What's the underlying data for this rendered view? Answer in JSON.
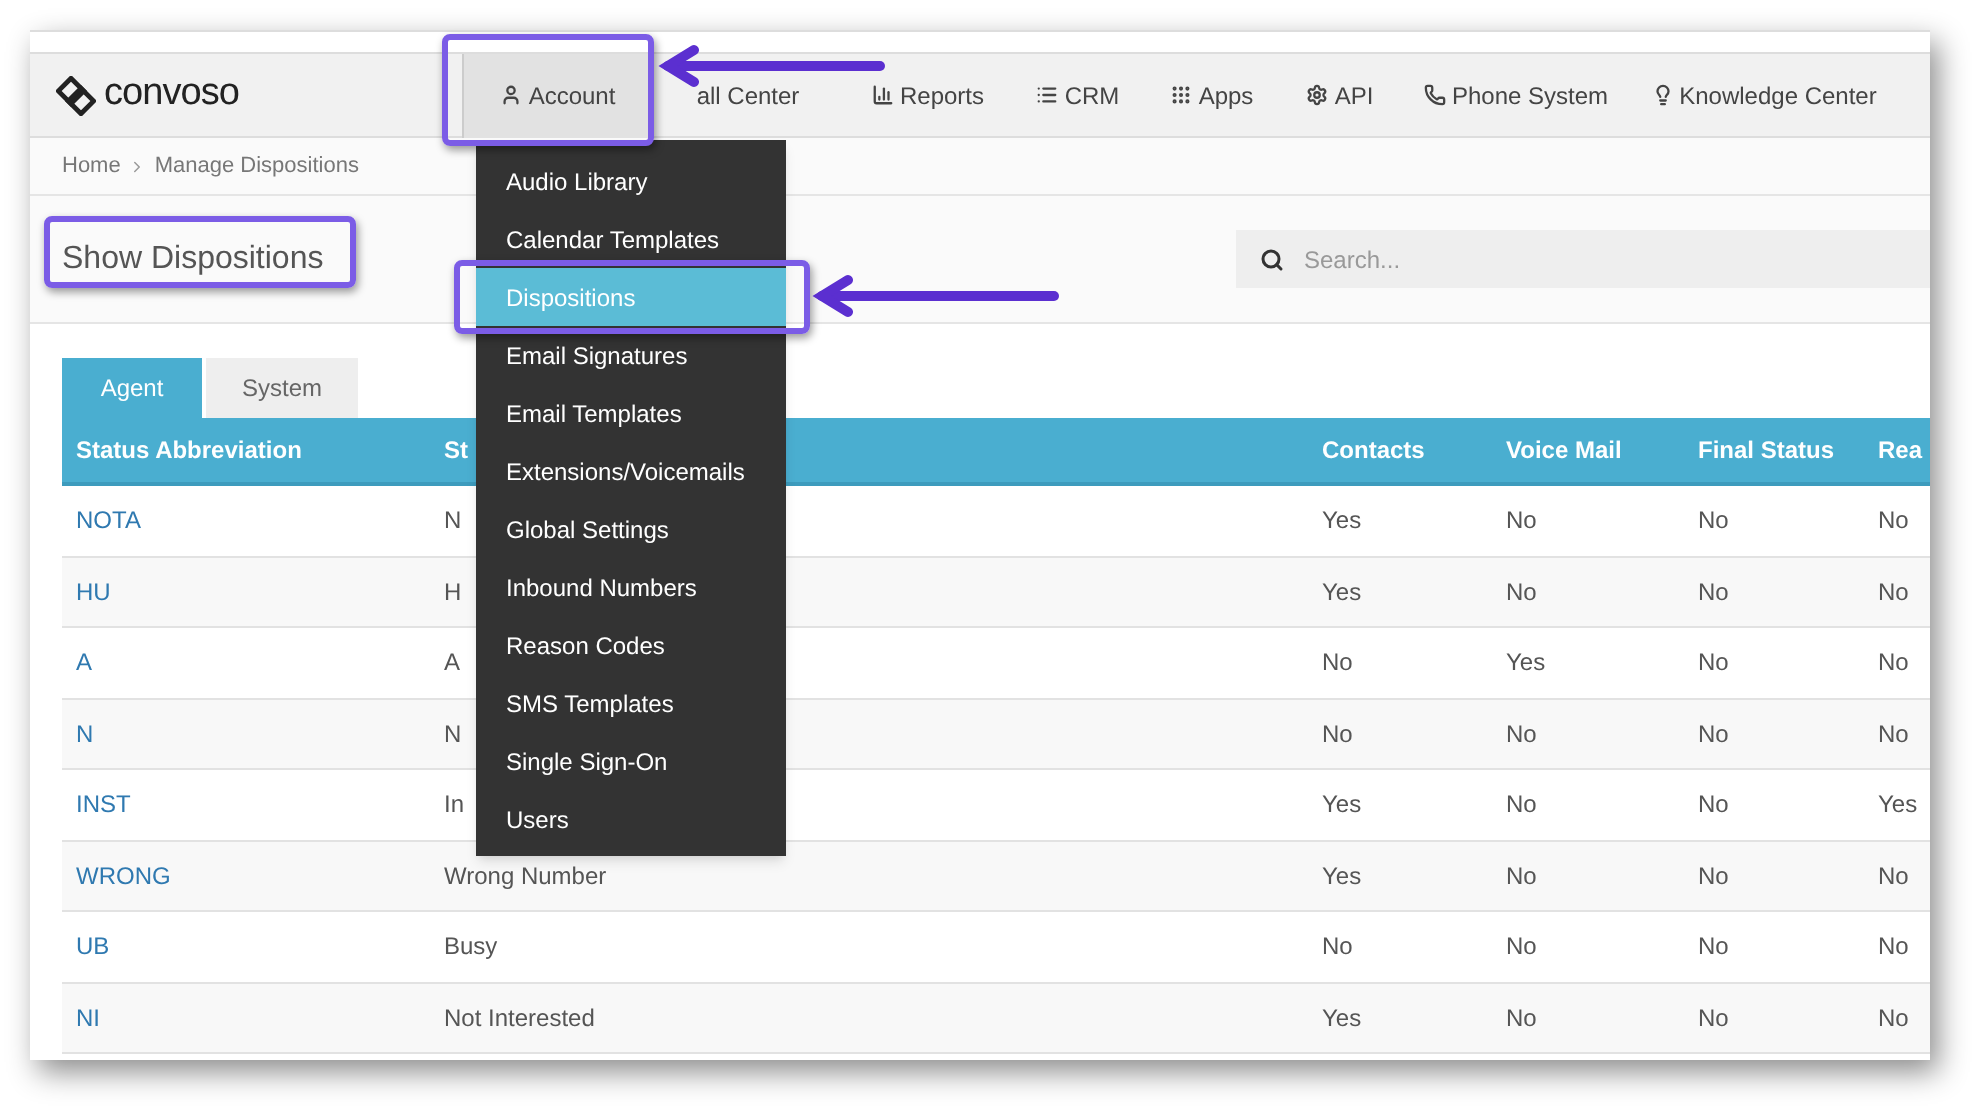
{
  "logo": {
    "text": "convoso"
  },
  "nav": [
    {
      "label": "Account",
      "selected": true
    },
    {
      "label": "all Center",
      "selected": false
    },
    {
      "label": "Reports",
      "selected": false
    },
    {
      "label": "CRM",
      "selected": false
    },
    {
      "label": "Apps",
      "selected": false
    },
    {
      "label": "API",
      "selected": false
    },
    {
      "label": "Phone System",
      "selected": false
    },
    {
      "label": "Knowledge Center",
      "selected": false
    }
  ],
  "account_menu": [
    {
      "label": "Audio Library",
      "selected": false
    },
    {
      "label": "Calendar Templates",
      "selected": false
    },
    {
      "label": "Dispositions",
      "selected": true
    },
    {
      "label": "Email Signatures",
      "selected": false
    },
    {
      "label": "Email Templates",
      "selected": false
    },
    {
      "label": "Extensions/Voicemails",
      "selected": false
    },
    {
      "label": "Global Settings",
      "selected": false
    },
    {
      "label": "Inbound Numbers",
      "selected": false
    },
    {
      "label": "Reason Codes",
      "selected": false
    },
    {
      "label": "SMS Templates",
      "selected": false
    },
    {
      "label": "Single Sign-On",
      "selected": false
    },
    {
      "label": "Users",
      "selected": false
    }
  ],
  "breadcrumb": [
    "Home",
    "Manage Dispositions"
  ],
  "page_title": "Show Dispositions",
  "search": {
    "placeholder": "Search..."
  },
  "tabs": [
    {
      "label": "Agent",
      "selected": true
    },
    {
      "label": "System",
      "selected": false
    }
  ],
  "table": {
    "columns": [
      "Status Abbreviation",
      "St",
      "Contacts",
      "Voice Mail",
      "Final Status",
      "Rea"
    ],
    "rows": [
      {
        "cells": [
          "NOTA",
          "N",
          "Yes",
          "No",
          "No",
          "No"
        ]
      },
      {
        "cells": [
          "HU",
          "H",
          "Yes",
          "No",
          "No",
          "No"
        ]
      },
      {
        "cells": [
          "A",
          "A",
          "No",
          "Yes",
          "No",
          "No"
        ]
      },
      {
        "cells": [
          "N",
          "N",
          "No",
          "No",
          "No",
          "No"
        ]
      },
      {
        "cells": [
          "INST",
          "In",
          "Yes",
          "No",
          "No",
          "Yes"
        ]
      },
      {
        "cells": [
          "WRONG",
          "Wrong Number",
          "Yes",
          "No",
          "No",
          "No"
        ]
      },
      {
        "cells": [
          "UB",
          "Busy",
          "No",
          "No",
          "No",
          "No"
        ]
      },
      {
        "cells": [
          "NI",
          "Not Interested",
          "Yes",
          "No",
          "No",
          "No"
        ]
      }
    ]
  }
}
